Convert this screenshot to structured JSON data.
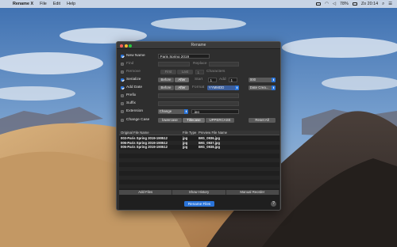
{
  "menubar": {
    "app_name": "Rename X",
    "menus": [
      "File",
      "Edit",
      "Help"
    ],
    "battery": "78%",
    "clock": "Zo 20:14"
  },
  "window": {
    "title": "Rename",
    "new_name": {
      "label": "New Name",
      "checked": true,
      "value": "Paris Spring 2019"
    },
    "find": {
      "label": "Find",
      "checked": false,
      "replace_label": "Replace"
    },
    "remove": {
      "label": "Remove",
      "checked": false,
      "first": "First",
      "last": "Last",
      "count": "1",
      "characters": "Characters"
    },
    "serialize": {
      "label": "Serialize",
      "checked": true,
      "before": "Before",
      "after": "After",
      "start_label": "Start",
      "start": "1",
      "add_label": "Add",
      "add": "1",
      "format": "000"
    },
    "add_date": {
      "label": "Add Date",
      "checked": true,
      "before": "Before",
      "after": "After",
      "format_label": "Format",
      "format": "YYMMDD",
      "source": "Date Crea..."
    },
    "prefix": {
      "label": "Prefix",
      "checked": false
    },
    "suffix": {
      "label": "Suffix",
      "checked": false
    },
    "extension": {
      "label": "Extension",
      "checked": false,
      "mode": "Change",
      "value": ".jpg"
    },
    "change_case": {
      "label": "Change Case",
      "checked": false,
      "lowercase": "lowercase",
      "titlecase": "Titlecase",
      "uppercase": "UPPERCASE",
      "reset": "Reset All"
    },
    "table": {
      "headers": [
        "Original File Name",
        "File Type",
        "Preview File Name"
      ],
      "rows": [
        [
          "003-Paris Spring 2019-190512",
          "jpg",
          "IMG_0936.jpg"
        ],
        [
          "006-Paris Spring 2019-190512",
          "jpg",
          "IMG_0937.jpg"
        ],
        [
          "005-Paris Spring 2019-190512",
          "jpg",
          "IMG_0938.jpg"
        ]
      ]
    },
    "bottom_buttons": [
      "Add Files",
      "Show History",
      "Manual Reorder"
    ],
    "rename_button": "Rename Files",
    "help": "?"
  }
}
